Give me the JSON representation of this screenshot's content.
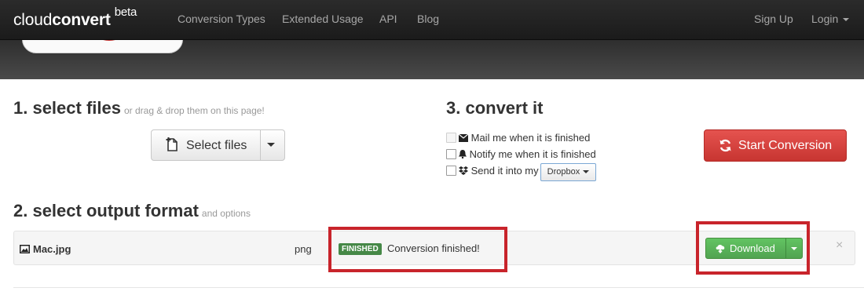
{
  "navbar": {
    "brand_normal": "cloud",
    "brand_bold": "convert",
    "brand_sup": "beta",
    "links": [
      "Conversion Types",
      "Extended Usage",
      "API",
      "Blog"
    ],
    "sign_up": "Sign Up",
    "login": "Login"
  },
  "step1": {
    "title": "1. select files",
    "hint": "or drag & drop them on this page!",
    "select_button": "Select files"
  },
  "step2": {
    "title": "2. select output format",
    "hint": "and options"
  },
  "step3": {
    "title": "3. convert it",
    "options": [
      {
        "label": "Mail me when it is finished",
        "icon": "envelope-icon"
      },
      {
        "label": "Notify me when it is finished",
        "icon": "bell-icon"
      },
      {
        "label": "Send it into my",
        "icon": "dropbox-icon"
      }
    ],
    "dropbox_select": "Dropbox",
    "start_button": "Start Conversion"
  },
  "file_row": {
    "name": "Mac.jpg",
    "format": "png",
    "status_badge": "FINISHED",
    "status_text": "Conversion finished!",
    "download_button": "Download",
    "close": "×"
  },
  "colors": {
    "navbar": "#1b1b1b",
    "start_button": "#d9534f",
    "download_button": "#5bb75b",
    "finished_badge": "#468847",
    "annotation": "#c8242b"
  }
}
